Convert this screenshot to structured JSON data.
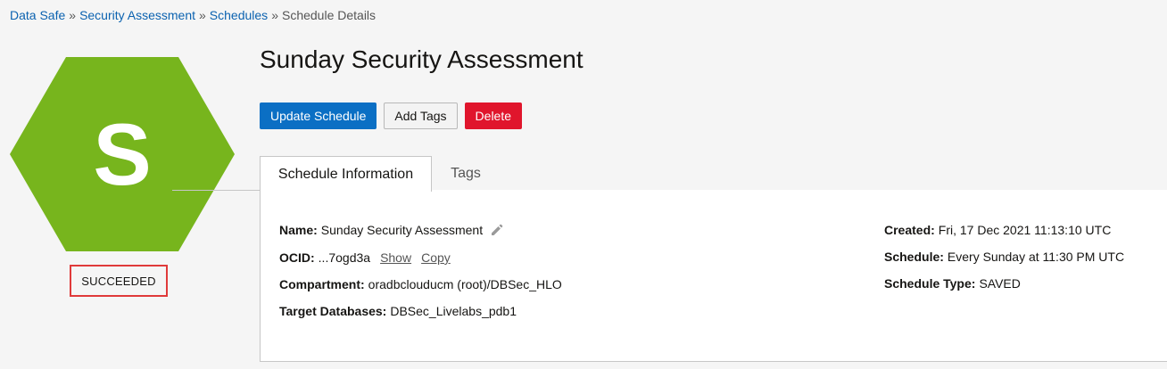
{
  "breadcrumb": {
    "items": [
      "Data Safe",
      "Security Assessment",
      "Schedules"
    ],
    "separator": "»",
    "current": "Schedule Details"
  },
  "badge": {
    "letter": "S",
    "status": "SUCCEEDED",
    "hex_color": "#77b51d",
    "icon": "hexagon-icon"
  },
  "page_title": "Sunday Security Assessment",
  "actions": {
    "update_label": "Update Schedule",
    "add_tags_label": "Add Tags",
    "delete_label": "Delete"
  },
  "tabs": {
    "info_label": "Schedule Information",
    "tags_label": "Tags"
  },
  "info": {
    "name_label": "Name:",
    "name_value": "Sunday Security Assessment",
    "edit_icon": "pencil-icon",
    "ocid_label": "OCID:",
    "ocid_value": "...7ogd3a",
    "show_label": "Show",
    "copy_label": "Copy",
    "compartment_label": "Compartment:",
    "compartment_value": "oradbclouducm (root)/DBSec_HLO",
    "targets_label": "Target Databases:",
    "targets_value": "DBSec_Livelabs_pdb1",
    "created_label": "Created:",
    "created_value": "Fri, 17 Dec 2021 11:13:10 UTC",
    "schedule_label": "Schedule:",
    "schedule_value": "Every Sunday at 11:30 PM UTC",
    "schedule_type_label": "Schedule Type:",
    "schedule_type_value": "SAVED"
  },
  "colors": {
    "primary": "#0b6fc4",
    "danger": "#e0152c",
    "link": "#0b62b0",
    "status_outline": "#e03a3a"
  }
}
